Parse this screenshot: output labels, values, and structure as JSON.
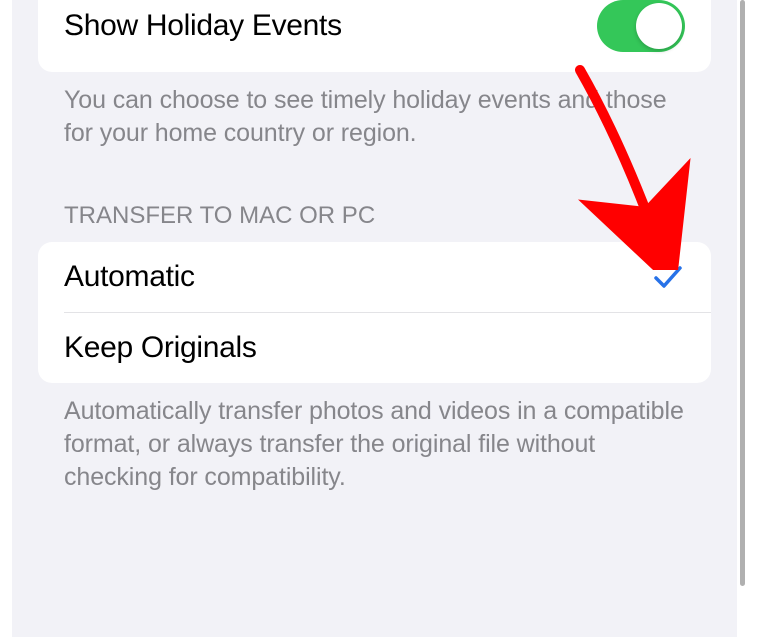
{
  "holiday_row": {
    "label": "Show Holiday Events",
    "toggled_on": true
  },
  "holiday_footer": "You can choose to see timely holiday events and those for your home country or region.",
  "transfer_section": {
    "header": "Transfer to Mac or PC",
    "options": [
      {
        "label": "Automatic",
        "selected": true
      },
      {
        "label": "Keep Originals",
        "selected": false
      }
    ],
    "footer": "Automatically transfer photos and videos in a compatible format, or always transfer the original file without checking for compatibility."
  },
  "annotation": {
    "type": "arrow",
    "color": "#ff0000"
  }
}
